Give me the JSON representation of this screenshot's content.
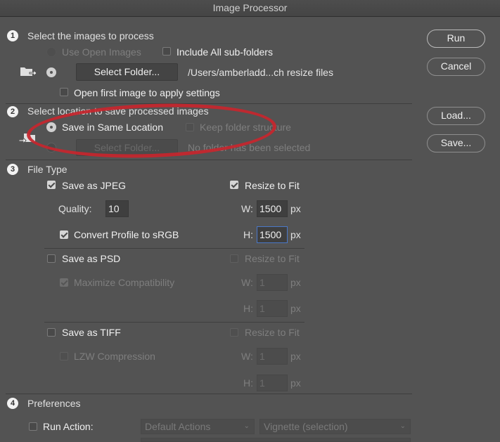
{
  "window": {
    "title": "Image Processor"
  },
  "buttons": {
    "run": "Run",
    "cancel": "Cancel",
    "load": "Load...",
    "save": "Save..."
  },
  "section1": {
    "number": "1",
    "title": "Select the images to process",
    "use_open_images": "Use Open Images",
    "include_subfolders": "Include All sub-folders",
    "select_folder": "Select Folder...",
    "folder_path": "/Users/amberladd...ch resize files",
    "open_first_image": "Open first image to apply settings"
  },
  "section2": {
    "number": "2",
    "title": "Select location to save processed images",
    "save_same_location": "Save in Same Location",
    "keep_folder_structure": "Keep folder structure",
    "select_folder": "Select Folder...",
    "no_folder": "No folder has been selected"
  },
  "section3": {
    "number": "3",
    "title": "File Type",
    "jpeg": {
      "save_label": "Save as JPEG",
      "save_checked": true,
      "resize_label": "Resize to Fit",
      "resize_checked": true,
      "quality_label": "Quality:",
      "quality_value": "10",
      "w_label": "W:",
      "w_value": "1500",
      "h_label": "H:",
      "h_value": "1500",
      "unit": "px",
      "convert_label": "Convert Profile to sRGB",
      "convert_checked": true
    },
    "psd": {
      "save_label": "Save as PSD",
      "save_checked": false,
      "resize_label": "Resize to Fit",
      "resize_checked": false,
      "maximize_label": "Maximize Compatibility",
      "maximize_checked": true,
      "w_label": "W:",
      "w_value": "1",
      "h_label": "H:",
      "h_value": "1",
      "unit": "px"
    },
    "tiff": {
      "save_label": "Save as TIFF",
      "save_checked": false,
      "resize_label": "Resize to Fit",
      "resize_checked": false,
      "lzw_label": "LZW Compression",
      "lzw_checked": false,
      "w_label": "W:",
      "w_value": "1",
      "h_label": "H:",
      "h_value": "1",
      "unit": "px"
    }
  },
  "section4": {
    "number": "4",
    "title": "Preferences",
    "run_action_label": "Run Action:",
    "action_set": "Default Actions",
    "action": "Vignette (selection)"
  },
  "annotation": {
    "color": "#c6262d"
  }
}
